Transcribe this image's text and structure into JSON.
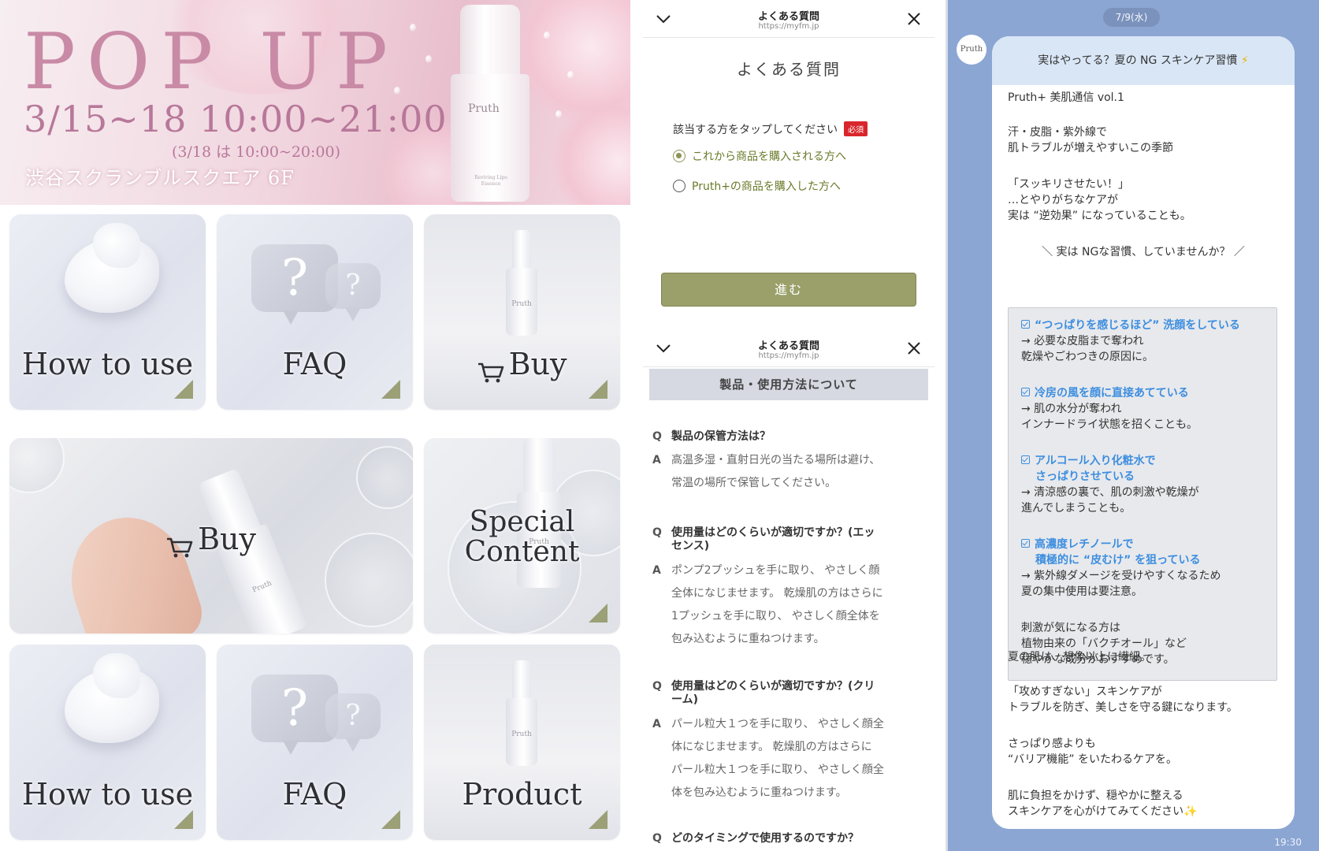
{
  "banner": {
    "title": "POP UP",
    "dates": "3/15~18 10:00~21:00",
    "note": "(3/18 は 10:00~20:00)",
    "venue": "渋谷スクランブルスクエア 6F",
    "bottle_brand": "Pruth",
    "bottle_sub": "Reviving Lipo Essence"
  },
  "menu_tiles": [
    {
      "label": "How to use"
    },
    {
      "label": "FAQ"
    },
    {
      "label": "Buy"
    },
    {
      "label": "Buy"
    },
    {
      "label": "Special Content"
    },
    {
      "label": "How to use"
    },
    {
      "label": "FAQ"
    },
    {
      "label": "Product"
    }
  ],
  "bottle_brand_small": "Pruth",
  "liff_top": {
    "title": "よくある質問",
    "url": "https://myfm.jp",
    "page_title": "よくある質問",
    "prompt": "該当する方をタップしてください",
    "required": "必須",
    "options": [
      {
        "label": "これから商品を購入される方へ",
        "selected": true
      },
      {
        "label": "Pruth+の商品を購入した方へ",
        "selected": false
      }
    ],
    "next_label": "進む"
  },
  "liff_bottom": {
    "title": "よくある質問",
    "url": "https://myfm.jp",
    "section": "製品・使用方法について",
    "q_mark": "Q",
    "a_mark": "A",
    "qa": [
      {
        "q": "製品の保管方法は？",
        "a": [
          "高温多湿・直射日光の当たる場所は避け、",
          "常温の場所で保管してください。"
        ]
      },
      {
        "q": [
          "使用量はどのくらいが適切ですか？(エッ",
          "センス)"
        ],
        "a": [
          "ポンプ2プッシュを手に取り、 やさしく顔",
          "全体になじませます。 乾燥肌の方はさらに",
          "1プッシュを手に取り、 やさしく顔全体を",
          "包み込むように重ねつけます。"
        ]
      },
      {
        "q": [
          "使用量はどのくらいが適切ですか？(クリ",
          "ーム)"
        ],
        "a": [
          "パール粒大１つを手に取り、 やさしく顔全",
          "体になじませます。 乾燥肌の方はさらに",
          "パール粒大１つを手に取り、 やさしく顔全",
          "体を包み込むように重ねつけます。"
        ]
      },
      {
        "q": "どのタイミングで使用するのですか？"
      }
    ]
  },
  "chat": {
    "date": "7/9(水)",
    "avatar_label": "Pruth",
    "header": "実はやってる？夏の NG スキンケア習慣",
    "header_icon": "⚡",
    "lines_top": [
      "Pruth+ 美肌通信 vol.1",
      "汗・皮脂・紫外線で",
      "肌トラブルが増えやすいこの季節",
      "「スッキリさせたい！」",
      "…とやりがちなケアが",
      "実は “逆効果” になっていることも。",
      "＼ 実は NGな習慣、していませんか？ ／"
    ],
    "ng_items": [
      {
        "head": [
          "“つっぱりを感じるほど” 洗顔をしている"
        ],
        "body": [
          "→ 必要な皮脂まで奪われ",
          "乾燥やごわつきの原因に。"
        ]
      },
      {
        "head": [
          "冷房の風を顔に直接あてている"
        ],
        "body": [
          "→ 肌の水分が奪われ",
          "インナードライ状態を招くことも。"
        ]
      },
      {
        "head": [
          "アルコール入り化粧水で",
          "さっぱりさせている"
        ],
        "body": [
          "→ 清涼感の裏で、肌の刺激や乾燥が",
          "進んでしまうことも。"
        ]
      },
      {
        "head": [
          "高濃度レチノールで",
          "積極的に “皮むけ” を狙っている"
        ],
        "body": [
          "→ 紫外線ダメージを受けやすくなるため",
          "夏の集中使用は要注意。"
        ]
      }
    ],
    "callout_tail": [
      "刺激が気になる方は",
      "植物由来の「バクチオール」など",
      "穏やかな成分がおすすめです。"
    ],
    "lines_bottom": [
      "夏の肌は、想像以上に繊細。",
      "「攻めすぎない」スキンケアが",
      "トラブルを防ぎ、美しさを守る鍵になります。",
      "さっぱり感よりも",
      "“バリア機能” をいたわるケアを。",
      "肌に負担をかけず、穏やかに整える",
      "スキンケアを心がけてみてください✨"
    ],
    "time": "19:30"
  }
}
